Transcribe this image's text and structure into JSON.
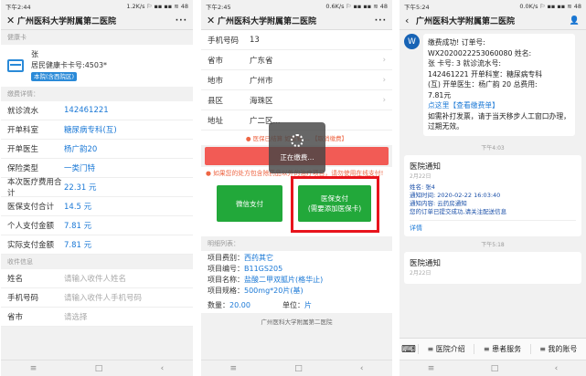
{
  "phone1": {
    "status": {
      "time": "下午2:44",
      "right": "1.2K/s ⚐ ▪▪ ▪▪ ≋ 48"
    },
    "title": "广州医科大学附属第二医院",
    "section_card": "健康卡",
    "card": {
      "name": "张",
      "number": "居民健康卡卡号:4503*",
      "badge": "本院(含西院区)"
    },
    "section_fee": "缴费详情：",
    "fees": [
      {
        "label": "就诊流水",
        "value": "142461221"
      },
      {
        "label": "开单科室",
        "value": "糖尿病专科(互)"
      },
      {
        "label": "开单医生",
        "value": "杨广韵20"
      },
      {
        "label": "保险类型",
        "value": "一类门特"
      },
      {
        "label": "本次医疗费用合计",
        "value": "22.31 元"
      },
      {
        "label": "医保支付合计",
        "value": "14.5 元"
      },
      {
        "label": "个人支付金额",
        "value": "7.81 元"
      },
      {
        "label": "实际支付金额",
        "value": "7.81 元"
      }
    ],
    "section_recv": "收件信息",
    "recv": [
      {
        "label": "姓名",
        "placeholder": "请输入收件人姓名"
      },
      {
        "label": "手机号码",
        "placeholder": "请输入收件人手机号码"
      },
      {
        "label": "省市",
        "placeholder": "请选择"
      }
    ]
  },
  "phone2": {
    "status": {
      "time": "下午2:45",
      "right": "0.6K/s ⚐ ▪▪ ▪▪ ≋ 48"
    },
    "title": "广州医科大学附属第二医院",
    "fields": [
      {
        "label": "手机号码",
        "value": "13"
      },
      {
        "label": "省市",
        "value": "广东省"
      },
      {
        "label": "地市",
        "value": "广州市"
      },
      {
        "label": "县区",
        "value": "海珠区"
      },
      {
        "label": "地址",
        "value": "广二区..."
      }
    ],
    "warn1": "● 医保已结算 如需要 ... 【取消缴费】",
    "warn2": "● 如果您的处方包含除药品以外的治疗项目，请勿使用在线支付!",
    "wechat_pay": "微信支付",
    "medical_pay_line1": "医保支付",
    "medical_pay_line2": "(需要添加医保卡)",
    "loading": "正在缴费...",
    "section_detail": "明细列表：",
    "details": [
      {
        "k": "项目费别：",
        "v": "西药其它"
      },
      {
        "k": "项目编号：",
        "v": "B11GS205"
      },
      {
        "k": "项目名称：",
        "v": "盐酸二甲双胍片(格华止)"
      },
      {
        "k": "项目规格：",
        "v": "500mg*20片(基)"
      }
    ],
    "qty": {
      "k": "数量：",
      "v": "20.00",
      "unit_k": "单位：",
      "unit_v": "片"
    },
    "footer": "广州医科大学附属第二医院"
  },
  "phone3": {
    "status": {
      "time": "下午5:24",
      "right": "0.0K/s ⚐ ▪▪ ▪▪ ≋ 48"
    },
    "title": "广州医科大学附属第二医院",
    "avatar_letter": "W",
    "msg_lines": [
      "缴费成功! 订单号:",
      "WX2020022253060080 姓名:",
      "张     卡号:        3 就诊流水号:",
      "142461221 开单科室：糖尿病专科",
      "(互) 开单医生：杨广韵 20 总费用:",
      "7.81元"
    ],
    "msg_link": "点这里【查看缴费单】",
    "msg_tail": "如需补打发票，请于当天移步人工窗口办理，过期无效。",
    "time1": "下午4:03",
    "notice1": {
      "title": "医院通知",
      "date": "2月22日",
      "lines": [
        "姓名: 张4",
        "通知时间: 2020-02-22 16:03:40",
        "通知内容: 云药房通知",
        "您的订单已提交成功,请关注配送信息"
      ],
      "more": "详情"
    },
    "time2": "下午5:18",
    "notice2": {
      "title": "医院通知",
      "date": "2月22日"
    },
    "menu": [
      "≡ 医院介绍",
      "≡ 患者服务",
      "≡ 我的账号"
    ],
    "menu_keyboard": "⌨"
  },
  "nav": {
    "home": "≡",
    "square": "□",
    "back": "‹"
  }
}
